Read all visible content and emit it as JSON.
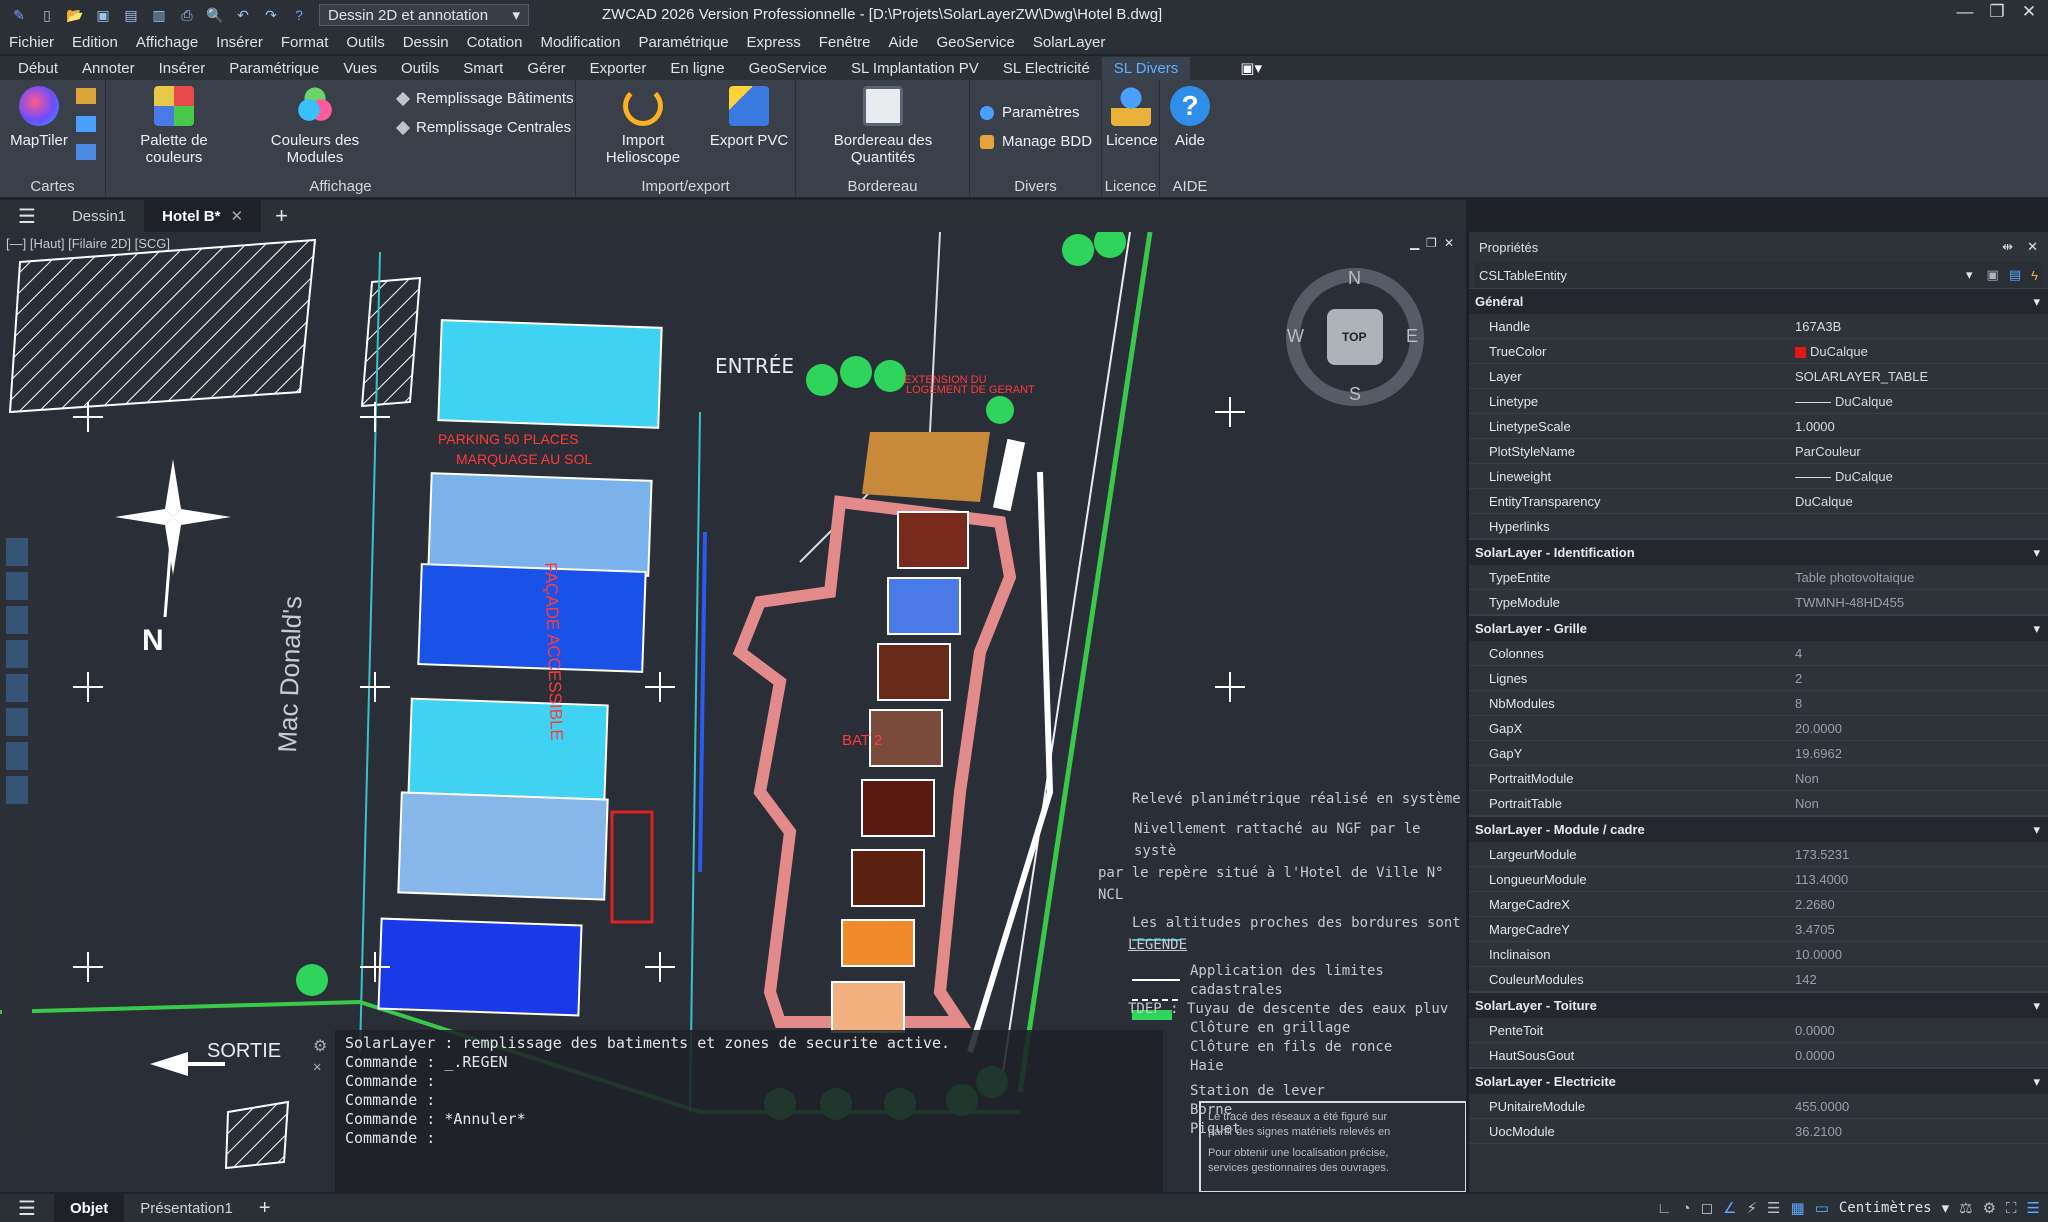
{
  "titlebar": {
    "workspace": "Dessin 2D et annotation",
    "title": "ZWCAD 2026 Version Professionnelle - [D:\\Projets\\SolarLayerZW\\Dwg\\Hotel B.dwg]"
  },
  "menu": [
    "Fichier",
    "Edition",
    "Affichage",
    "Insérer",
    "Format",
    "Outils",
    "Dessin",
    "Cotation",
    "Modification",
    "Paramétrique",
    "Express",
    "Fenêtre",
    "Aide",
    "GeoService",
    "SolarLayer"
  ],
  "ribbon_tabs": [
    "Début",
    "Annoter",
    "Insérer",
    "Paramétrique",
    "Vues",
    "Outils",
    "Smart",
    "Gérer",
    "Exporter",
    "En ligne",
    "GeoService",
    "SL Implantation PV",
    "SL Electricité",
    "SL Divers"
  ],
  "ribbon": {
    "cartes": {
      "label": "Cartes",
      "mapTiler": "MapTiler"
    },
    "affichage": {
      "label": "Affichage",
      "palette": "Palette de couleurs",
      "couleurs": "Couleurs des Modules",
      "remplBat": "Remplissage Bâtiments",
      "remplCent": "Remplissage Centrales"
    },
    "import": {
      "label": "Import/export",
      "helio": "Import Helioscope",
      "pvc": "Export PVC"
    },
    "bordereau": {
      "label": "Bordereau",
      "quant": "Bordereau des Quantités"
    },
    "divers": {
      "label": "Divers",
      "param": "Paramètres",
      "bdd": "Manage BDD"
    },
    "licence": {
      "label": "Licence",
      "btn": "Licence"
    },
    "aide": {
      "label": "AIDE",
      "btn": "Aide"
    }
  },
  "doctabs": [
    "Dessin1",
    "Hotel B*"
  ],
  "viewport": {
    "label": "[—] [Haut] [Filaire 2D] [SCG]"
  },
  "drawing": {
    "entree": "ENTRÉE",
    "sortie": "SORTIE",
    "parking1": "PARKING 50 PLACES",
    "parking2": "MARQUAGE AU SOL",
    "facade": "FAÇADE ACCESSIBLE",
    "macdonalds": "Mac Donald's",
    "north": "N",
    "bat": "BAT 2",
    "ext1": "EXTENSION DU",
    "ext2": "LOGEMENT DE GERANT",
    "releve": "Relevé planimétrique réalisé en système",
    "nivel1": "Nivellement rattaché au NGF par le systè",
    "nivel2": "par le repère situé à l'Hotel de Ville N° NCL",
    "altitudes": "Les altitudes proches des bordures sont",
    "legende": "LEGENDE",
    "legend_items": [
      "Application des limites cadastrales",
      "TDEP : Tuyau de descente des eaux pluv",
      "Clôture en grillage",
      "Clôture en fils de ronce",
      "Haie",
      "Station de lever",
      "Borne",
      "Piquet"
    ],
    "note1": "Le tracé des réseaux a été figuré sur",
    "note2": "partir des signes matériels relevés en",
    "note3": "Pour obtenir une localisation précise,",
    "note4": "services gestionnaires des ouvrages.",
    "compass": {
      "n": "N",
      "s": "S",
      "e": "E",
      "w": "W",
      "top": "TOP"
    }
  },
  "command": [
    "SolarLayer : remplissage des batiments et zones de securite active.",
    "Commande : _.REGEN",
    "Commande :",
    "Commande :",
    "Commande : *Annuler*",
    "Commande :"
  ],
  "properties": {
    "title": "Propriétés",
    "entity": "CSLTableEntity",
    "sections": [
      {
        "name": "Général",
        "rows": [
          [
            "Handle",
            "167A3B"
          ],
          [
            "TrueColor",
            "DuCalque"
          ],
          [
            "Layer",
            "SOLARLAYER_TABLE"
          ],
          [
            "Linetype",
            "DuCalque"
          ],
          [
            "LinetypeScale",
            "1.0000"
          ],
          [
            "PlotStyleName",
            "ParCouleur"
          ],
          [
            "Lineweight",
            "DuCalque"
          ],
          [
            "EntityTransparency",
            "DuCalque"
          ],
          [
            "Hyperlinks",
            ""
          ]
        ]
      },
      {
        "name": "SolarLayer - Identification",
        "rows": [
          [
            "TypeEntite",
            "Table photovoltaique"
          ],
          [
            "TypeModule",
            "TWMNH-48HD455"
          ]
        ]
      },
      {
        "name": "SolarLayer - Grille",
        "rows": [
          [
            "Colonnes",
            "4"
          ],
          [
            "Lignes",
            "2"
          ],
          [
            "NbModules",
            "8"
          ],
          [
            "GapX",
            "20.0000"
          ],
          [
            "GapY",
            "19.6962"
          ],
          [
            "PortraitModule",
            "Non"
          ],
          [
            "PortraitTable",
            "Non"
          ]
        ]
      },
      {
        "name": "SolarLayer - Module / cadre",
        "rows": [
          [
            "LargeurModule",
            "173.5231"
          ],
          [
            "LongueurModule",
            "113.4000"
          ],
          [
            "MargeCadreX",
            "2.2680"
          ],
          [
            "MargeCadreY",
            "3.4705"
          ],
          [
            "Inclinaison",
            "10.0000"
          ],
          [
            "CouleurModules",
            "142"
          ]
        ]
      },
      {
        "name": "SolarLayer - Toiture",
        "rows": [
          [
            "PenteToit",
            "0.0000"
          ],
          [
            "HautSousGout",
            "0.0000"
          ]
        ]
      },
      {
        "name": "SolarLayer - Electricite",
        "rows": [
          [
            "PUnitaireModule",
            "455.0000"
          ],
          [
            "UocModule",
            "36.2100"
          ]
        ]
      }
    ]
  },
  "statusbar": {
    "tabs": [
      "Objet",
      "Présentation1"
    ],
    "units": "Centimètres"
  },
  "colors": {
    "truecolor": "#e01818"
  }
}
